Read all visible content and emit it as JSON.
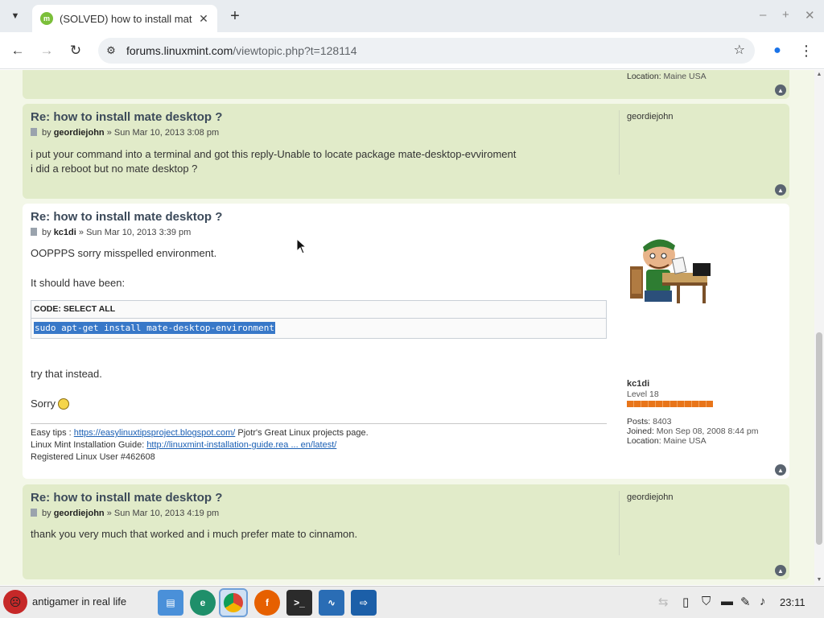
{
  "browser": {
    "tab_title": "(SOLVED) how to install mat",
    "url_host": "forums.linuxmint.com",
    "url_path": "/viewtopic.php?t=128114"
  },
  "top_fragment": {
    "location_label": "Location:",
    "location_value": "Maine USA"
  },
  "posts": [
    {
      "title": "Re: how to install mate desktop ?",
      "by": "by",
      "author": "geordiejohn",
      "date": "» Sun Mar 10, 2013 3:08 pm",
      "lines": [
        "i put your command into a terminal and got this reply-Unable to locate package mate-desktop-evviroment",
        "i did a reboot but no mate desktop ?"
      ],
      "profile_name": "geordiejohn"
    },
    {
      "title": "Re: how to install mate desktop ?",
      "by": "by",
      "author": "kc1di",
      "date": "» Sun Mar 10, 2013 3:39 pm",
      "line1": "OOPPPS sorry misspelled environment.",
      "line2": "It should have been:",
      "code_header": "CODE: SELECT ALL",
      "code": "sudo apt-get install mate-desktop-environment",
      "line3": "try that instead.",
      "line4": "Sorry",
      "sig": {
        "l1_prefix": "Easy tips : ",
        "l1_link": "https://easylinuxtipsproject.blogspot.com/",
        "l1_suffix": " Pjotr's Great Linux projects page.",
        "l2_prefix": "Linux Mint Installation Guide: ",
        "l2_link": "http://linuxmint-installation-guide.rea ... en/latest/",
        "l3": "Registered Linux User #462608"
      },
      "profile_name": "kc1di",
      "rank": "Level 18",
      "posts_label": "Posts:",
      "posts_value": "8403",
      "joined_label": "Joined:",
      "joined_value": "Mon Sep 08, 2008 8:44 pm",
      "location_label": "Location:",
      "location_value": "Maine USA"
    },
    {
      "title": "Re: how to install mate desktop ?",
      "by": "by",
      "author": "geordiejohn",
      "date": "» Sun Mar 10, 2013 4:19 pm",
      "line1": "thank you very much that worked and i much prefer mate to cinnamon.",
      "profile_name": "geordiejohn"
    }
  ],
  "taskbar": {
    "start_label": "antigamer in real life",
    "apps": [
      "files-icon",
      "edge-dev-icon",
      "chrome-icon",
      "firefox-icon",
      "terminal-icon",
      "system-monitor-icon",
      "remote-desktop-icon"
    ],
    "clock": "23:11"
  },
  "colors": {
    "post_green": "#e1ebc9",
    "title_color": "#3c4a5a",
    "link_color": "#1a5fb4",
    "rank_orange": "#e8751a"
  }
}
